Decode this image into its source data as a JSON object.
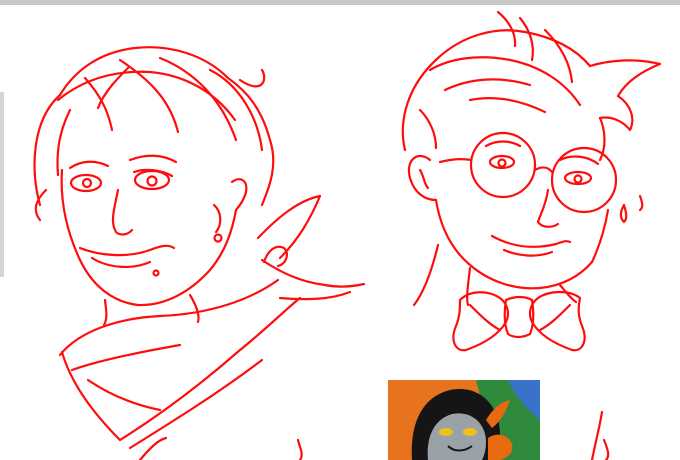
{
  "canvas": {
    "background": "#ffffff",
    "ink_color": "#ff0d0d",
    "chrome_color": "#c8c8c8"
  },
  "sketches": [
    {
      "name": "left-portrait-scarf"
    },
    {
      "name": "right-portrait-glasses-bowtie"
    }
  ],
  "reference_thumbnail": {
    "colors": {
      "bg_orange": "#e8731e",
      "bg_green": "#2f8a3b",
      "bg_blue": "#3a72c9",
      "skin": "#9aa2a8",
      "hair": "#151515",
      "eye": "#f0c020",
      "horn": "#e86a10"
    }
  }
}
